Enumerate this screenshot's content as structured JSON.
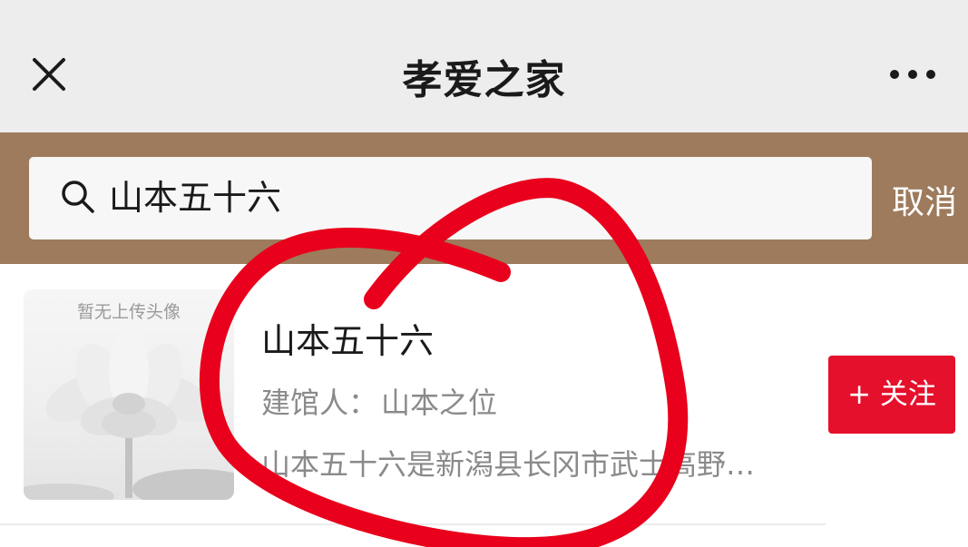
{
  "header": {
    "title": "孝爱之家",
    "close_icon": "close-icon",
    "more_icon": "more-dots-icon"
  },
  "search": {
    "query": "山本五十六",
    "icon": "search-icon",
    "cancel_label": "取消"
  },
  "results": [
    {
      "avatar_caption": "暂无上传头像",
      "avatar_icon": "lotus-image",
      "name": "山本五十六",
      "owner_label": "建馆人：",
      "owner_name": "山本之位",
      "description": "山本五十六是新潟县长冈市武士高野…",
      "follow_label": "+ 关注"
    }
  ],
  "colors": {
    "header_bg": "#ededed",
    "search_band_bg": "#9d7b5c",
    "follow_button_bg": "#e5102b",
    "annotation_red": "#e8001c"
  }
}
